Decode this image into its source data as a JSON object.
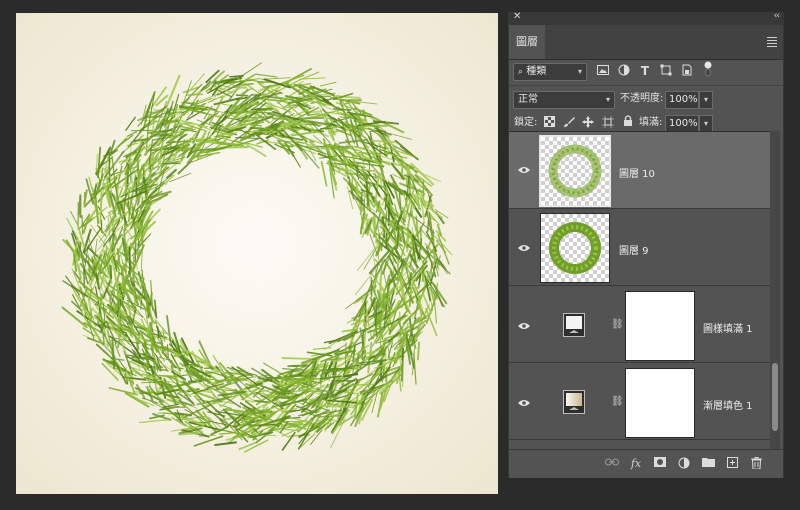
{
  "panel": {
    "title": "圖層",
    "close_icon": "close-icon",
    "collapse_icon": "collapse-icon",
    "menu_icon": "panel-menu-icon"
  },
  "filter": {
    "kind_label": "種類",
    "icons": [
      "image-filter-icon",
      "adjustment-filter-icon",
      "type-filter-icon",
      "shape-filter-icon",
      "smart-object-filter-icon",
      "filter-toggle-icon"
    ]
  },
  "blend": {
    "mode": "正常",
    "opacity_label": "不透明度:",
    "opacity_value": "100%"
  },
  "lock": {
    "label": "鎖定:",
    "icons": [
      "lock-transparent-icon",
      "lock-paint-icon",
      "lock-position-icon",
      "lock-artboard-icon",
      "lock-all-icon"
    ],
    "fill_label": "填滿:",
    "fill_value": "100%"
  },
  "layers": [
    {
      "name": "圖層 10",
      "visible": true,
      "selected": true,
      "type": "pixel"
    },
    {
      "name": "圖層 9",
      "visible": true,
      "selected": false,
      "type": "pixel"
    },
    {
      "name": "圖樣填滿 1",
      "visible": true,
      "selected": false,
      "type": "pattern-fill"
    },
    {
      "name": "漸層填色 1",
      "visible": true,
      "selected": false,
      "type": "gradient-fill"
    }
  ],
  "footer_icons": [
    "link-layers-icon",
    "fx-icon",
    "add-mask-icon",
    "new-adjustment-icon",
    "new-group-icon",
    "new-layer-icon",
    "delete-layer-icon"
  ],
  "footer": {
    "fx_text": "fx"
  },
  "colors": {
    "panel_bg": "#535353",
    "selected_layer": "#6a6a6a",
    "wreath_green": "#7aa829"
  }
}
